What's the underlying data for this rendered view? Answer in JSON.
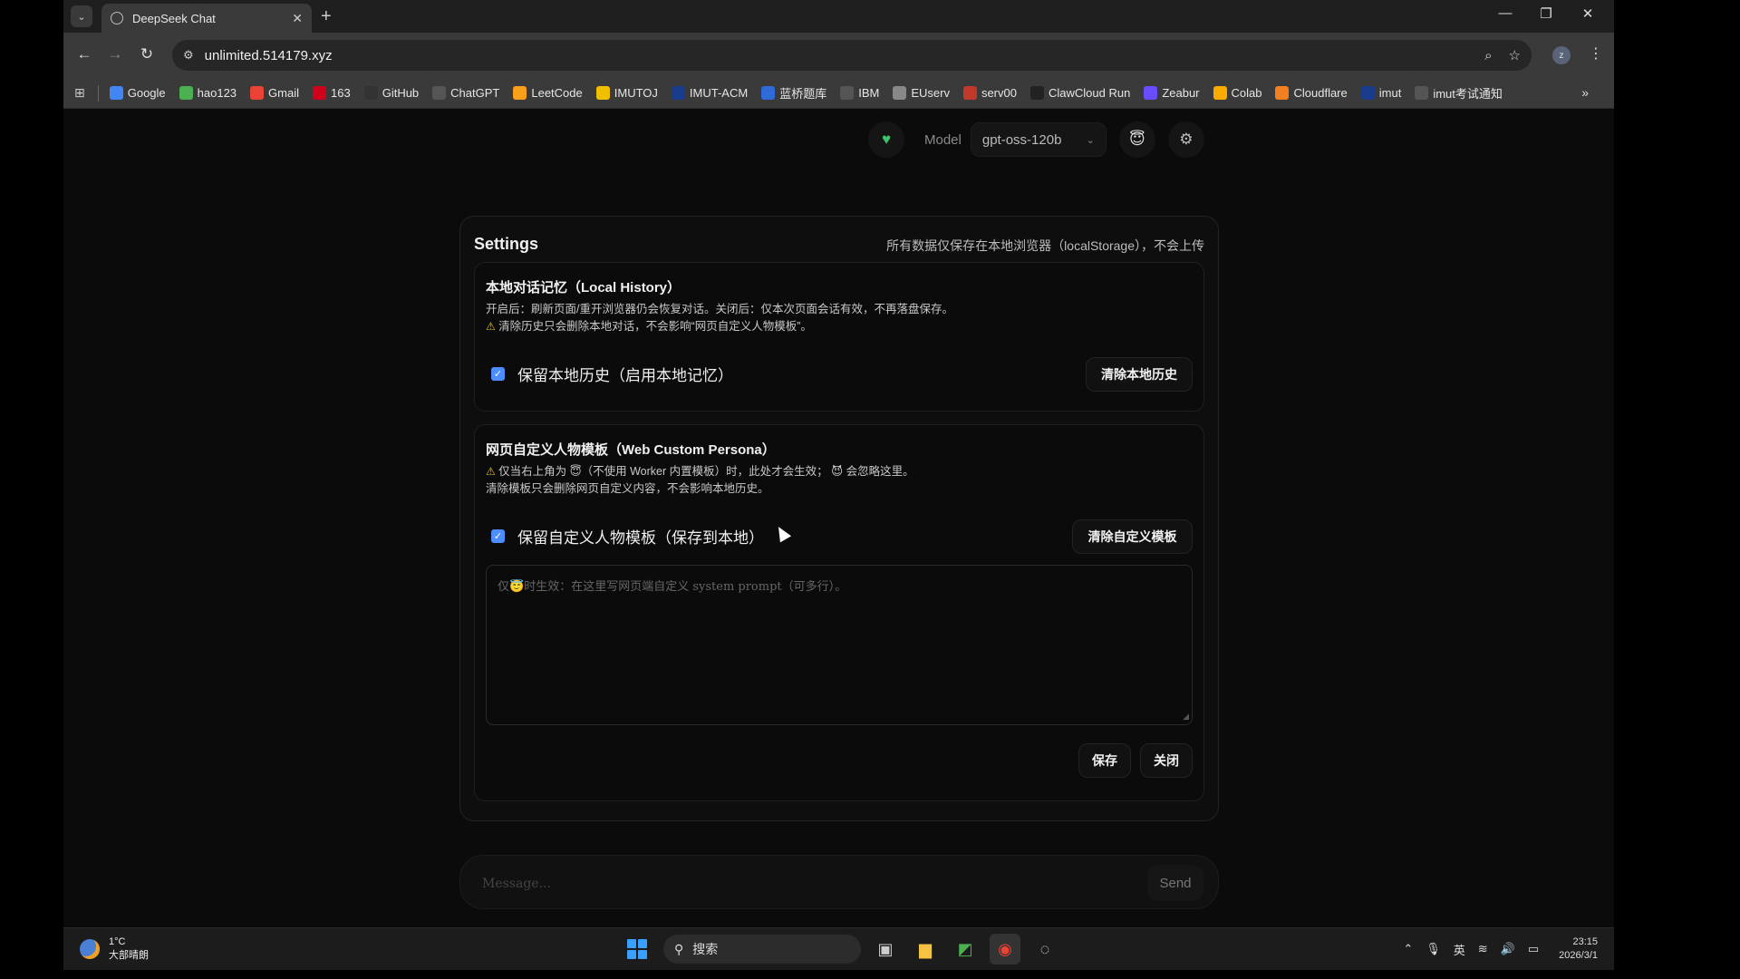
{
  "browser": {
    "tab_title": "DeepSeek Chat",
    "url": "unlimited.514179.xyz",
    "bookmarks": [
      {
        "label": "Google",
        "icon": "google-icon",
        "color": "#4285f4"
      },
      {
        "label": "hao123",
        "icon": "hao123-icon",
        "color": "#4caf50"
      },
      {
        "label": "Gmail",
        "icon": "gmail-icon",
        "color": "#ea4335"
      },
      {
        "label": "163",
        "icon": "163-icon",
        "color": "#d0021b"
      },
      {
        "label": "GitHub",
        "icon": "github-icon",
        "color": "#333333"
      },
      {
        "label": "ChatGPT",
        "icon": "chatgpt-icon",
        "color": "#555555"
      },
      {
        "label": "LeetCode",
        "icon": "leetcode-icon",
        "color": "#f89f1b"
      },
      {
        "label": "IMUTOJ",
        "icon": "imutoj-icon",
        "color": "#f0c000"
      },
      {
        "label": "IMUT-ACM",
        "icon": "imut-acm-icon",
        "color": "#1a3c8c"
      },
      {
        "label": "蓝桥题库",
        "icon": "lanqiao-icon",
        "color": "#2f6bd8"
      },
      {
        "label": "IBM",
        "icon": "globe-icon",
        "color": "#555555"
      },
      {
        "label": "EUserv",
        "icon": "euserv-icon",
        "color": "#888888"
      },
      {
        "label": "serv00",
        "icon": "serv00-icon",
        "color": "#c0392b"
      },
      {
        "label": "ClawCloud Run",
        "icon": "clawcloud-icon",
        "color": "#222222"
      },
      {
        "label": "Zeabur",
        "icon": "zeabur-icon",
        "color": "#6a4cff"
      },
      {
        "label": "Colab",
        "icon": "colab-icon",
        "color": "#f9ab00"
      },
      {
        "label": "Cloudflare",
        "icon": "cloudflare-icon",
        "color": "#f38020"
      },
      {
        "label": "imut",
        "icon": "imut-icon",
        "color": "#1a3c8c"
      },
      {
        "label": "imut考试通知",
        "icon": "globe-icon",
        "color": "#555555"
      }
    ]
  },
  "topbar": {
    "model_label": "Model",
    "model_value": "gpt-oss-120b"
  },
  "settings": {
    "title": "Settings",
    "note": "所有数据仅保存在本地浏览器（localStorage），不会上传",
    "history": {
      "title": "本地对话记忆（Local History）",
      "desc_line1": "开启后：刷新页面/重开浏览器仍会恢复对话。关闭后：仅本次页面会话有效，不再落盘保存。",
      "desc_line2": "清除历史只会删除本地对话，不会影响“网页自定义人物模板”。",
      "checkbox_label": "保留本地历史（启用本地记忆）",
      "checked": true,
      "clear_button": "清除本地历史"
    },
    "persona": {
      "title": "网页自定义人物模板（Web Custom Persona）",
      "desc_line1_a": "仅当右上角为",
      "desc_line1_b": "（不使用 Worker 内置模板）时，此处才会生效；",
      "desc_line1_c": "会忽略这里。",
      "desc_line2": "清除模板只会删除网页自定义内容，不会影响本地历史。",
      "checkbox_label": "保留自定义人物模板（保存到本地）",
      "checked": true,
      "clear_button": "清除自定义模板",
      "textarea_placeholder_a": "仅",
      "textarea_placeholder_b": "时生效：在这里写网页端自定义 system prompt（可多行）。"
    },
    "save_button": "保存",
    "close_button": "关闭"
  },
  "composer": {
    "placeholder": "Message...",
    "send_label": "Send"
  },
  "taskbar": {
    "temperature": "1°C",
    "weather": "大部晴朗",
    "search_label": "搜索",
    "ime": "英",
    "time": "23:15",
    "date": "2026/3/1"
  }
}
